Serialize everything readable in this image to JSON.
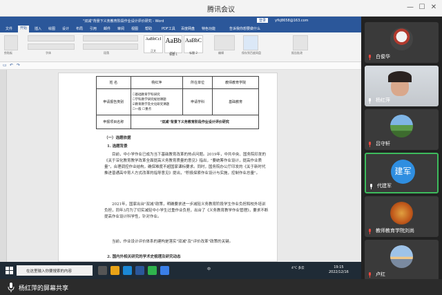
{
  "meeting": {
    "title": "腾讯会议",
    "share_label": "杨红萍的屏幕共享"
  },
  "word": {
    "doc_title": "\"双减\"背景下义务教育阶段作业设计评价研究 - Word",
    "user": "yfkj8658@163.com",
    "sign_in": "登录",
    "tabs": [
      "文件",
      "开始",
      "插入",
      "绘图",
      "设计",
      "布局",
      "引用",
      "邮件",
      "审阅",
      "视图",
      "帮助",
      "PDF工具",
      "百度网盘",
      "特色功能",
      "告诉我你想要做什么"
    ],
    "active_tab": "开始",
    "styles": [
      {
        "big": "AaBbCcI",
        "small": "正文"
      },
      {
        "big": "AaBb",
        "small": "标题 1"
      },
      {
        "big": "AaBbC",
        "small": "标题 2"
      }
    ],
    "groups": [
      "剪贴板",
      "字体",
      "段落",
      "样式",
      "编辑",
      "保存到百度网盘",
      "报告批改"
    ]
  },
  "form": {
    "name_label": "姓 名",
    "name_value": "杨红萍",
    "unit_label": "所在单位",
    "unit_value": "教师教育学院",
    "type_label": "申请报告类别",
    "type_options": [
      "☐基础教育学科研究",
      "☐学科教学研究规划课题",
      "☑教育教学及文化研究课题",
      "☐一般 ☐重点"
    ],
    "apply_label": "申请学科",
    "apply_value": "基础教育",
    "project_label": "申报项目名称",
    "project_value": "\"双减\"背景下义务教育阶段作业设计评价研究"
  },
  "body": {
    "heading1": "（一）选题依据",
    "heading2": "1. 选题背景",
    "p1": "目前，中小学作业已成为当下基础教育改革的热点问题。2019年，中共中央、国务院印发的《关于深化教育教学改革全面提高义务教育质量的意见》指出，\"要统筹作业设计，提高作业质量\"，合理调控作业结构，确保难度不超国家课标要求。同时，国务院办公厅印发的《关于新时代推进普通高中育人方式改革的指导意见》提出，\"积极探索作业设计与实施，控制作业总量\"。",
    "p2": "2021年，国家出台\"双减\"政策，明确要求进一步减轻义务教育阶段学生作业负担和校外培训负担，同年3月为了切实减轻中小学生过重作业负担，出台了《义务教育教学作业管理》，要求不断提高作业设计科学性，针对作业。",
    "p3": "当前，作业设计评价体系的建构是落实\"双减\"及\"评价改革\"政策的关键。",
    "heading3": "2. 国内外相关研究的学术史梳理及研究动态"
  },
  "taskbar": {
    "search": "在这里输入你要搜索的内容",
    "weather": "4°C 多云",
    "time": "19:15",
    "date": "2022/12/16",
    "lang": "中"
  },
  "participants": [
    {
      "name": "白俊华",
      "kind": "photo-fan",
      "active": false
    },
    {
      "name": "杨红萍",
      "kind": "photo-woman",
      "active": false
    },
    {
      "name": "吕守轩",
      "kind": "photo-landscape",
      "active": false
    },
    {
      "name": "代建军",
      "kind": "text",
      "avatar_text": "建军",
      "active": true
    },
    {
      "name": "教师教育学院刘尚",
      "kind": "photo-autumn",
      "active": false
    },
    {
      "name": "卢红",
      "kind": "photo-sunset",
      "active": false
    }
  ]
}
